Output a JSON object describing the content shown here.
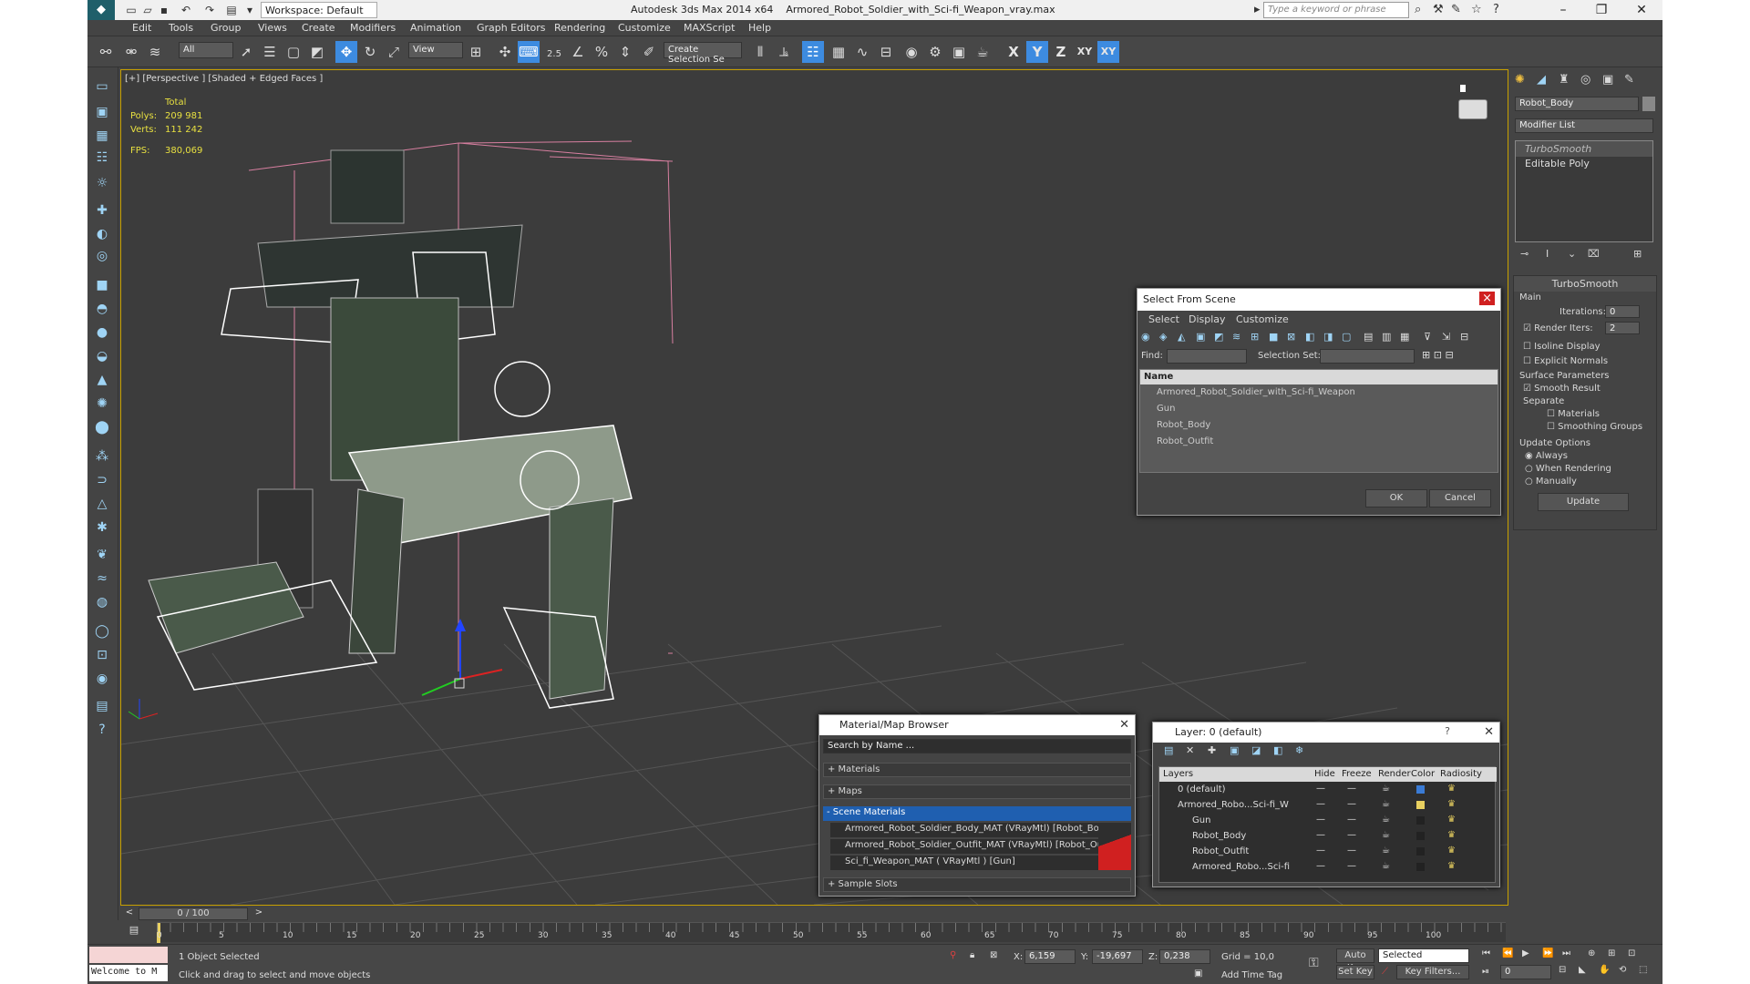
{
  "titlebar": {
    "workspace": "Workspace: Default",
    "app": "Autodesk 3ds Max  2014 x64",
    "file": "Armored_Robot_Soldier_with_Sci-fi_Weapon_vray.max",
    "search_placeholder": "Type a keyword or phrase"
  },
  "menu": [
    "Edit",
    "Tools",
    "Group",
    "Views",
    "Create",
    "Modifiers",
    "Animation",
    "Graph Editors",
    "Rendering",
    "Customize",
    "MAXScript",
    "Help"
  ],
  "toolbar": {
    "filter": "All",
    "refcoord": "View",
    "selset": "Create Selection Se",
    "snap_label": "2.5"
  },
  "viewport": {
    "label": "[+] [Perspective ] [Shaded + Edged Faces ]",
    "total": "Total",
    "polys_k": "Polys:",
    "polys_v": "209 981",
    "verts_k": "Verts:",
    "verts_v": "111 242",
    "fps_k": "FPS:",
    "fps_v": "380,069"
  },
  "command_panel": {
    "object_name": "Robot_Body",
    "modifier_list": "Modifier List",
    "stack": [
      "TurboSmooth",
      "Editable Poly"
    ],
    "turbosmooth": {
      "title": "TurboSmooth",
      "main": "Main",
      "iterations_label": "Iterations:",
      "iterations": "0",
      "render_iters_label": "Render Iters:",
      "render_iters": "2",
      "isoline": "Isoline Display",
      "explicit": "Explicit Normals",
      "surface": "Surface Parameters",
      "smooth_result": "Smooth Result",
      "separate": "Separate",
      "materials": "Materials",
      "smoothing": "Smoothing Groups",
      "update_options": "Update Options",
      "always": "Always",
      "when_rendering": "When Rendering",
      "manually": "Manually",
      "update_btn": "Update"
    }
  },
  "select_scene": {
    "title": "Select From Scene",
    "tabs": [
      "Select",
      "Display",
      "Customize"
    ],
    "find": "Find:",
    "selection_set": "Selection Set:",
    "col_name": "Name",
    "items": [
      "Armored_Robot_Soldier_with_Sci-fi_Weapon",
      "Gun",
      "Robot_Body",
      "Robot_Outfit"
    ],
    "ok": "OK",
    "cancel": "Cancel"
  },
  "mat_browser": {
    "title": "Material/Map Browser",
    "search": "Search by Name ...",
    "groups": [
      "+ Materials",
      "+ Maps",
      "- Scene Materials"
    ],
    "scene_mats": [
      "Armored_Robot_Soldier_Body_MAT (VRayMtl) [Robot_Body]",
      "Armored_Robot_Soldier_Outfit_MAT (VRayMtl) [Robot_Outfit]",
      "Sci_fi_Weapon_MAT ( VRayMtl ) [Gun]"
    ],
    "sample_slots": "+ Sample Slots"
  },
  "layer": {
    "title": "Layer: 0 (default)",
    "help": "?",
    "cols": [
      "Layers",
      "Hide",
      "Freeze",
      "Render",
      "Color",
      "Radiosity"
    ],
    "rows": [
      {
        "name": "0 (default)",
        "indent": 0,
        "color": "#3a7bd5"
      },
      {
        "name": "Armored_Robo...Sci-fi_W",
        "indent": 0,
        "color": "#e8d060"
      },
      {
        "name": "Gun",
        "indent": 1,
        "color": "#222222"
      },
      {
        "name": "Robot_Body",
        "indent": 1,
        "color": "#222222"
      },
      {
        "name": "Robot_Outfit",
        "indent": 1,
        "color": "#222222"
      },
      {
        "name": "Armored_Robo...Sci-fi",
        "indent": 1,
        "color": "#222222"
      }
    ]
  },
  "timeline": {
    "frame": "0 / 100",
    "ticks": [
      "0",
      "5",
      "10",
      "15",
      "20",
      "25",
      "30",
      "35",
      "40",
      "45",
      "50",
      "55",
      "60",
      "65",
      "70",
      "75",
      "80",
      "85",
      "90",
      "95",
      "100"
    ]
  },
  "status": {
    "maxscript": "Welcome to M",
    "selected": "1 Object Selected",
    "prompt": "Click and drag to select and move objects",
    "x_label": "X:",
    "x": "6,159",
    "y_label": "Y:",
    "y": "-19,697",
    "z_label": "Z:",
    "z": "0,238",
    "grid": "Grid = 10,0",
    "add_time_tag": "Add Time Tag",
    "auto_key": "Auto Key",
    "set_key": "Set Key",
    "key_mode": "Selected",
    "key_filters": "Key Filters...",
    "frame": "0"
  },
  "colors": {
    "accent": "#3d8be0",
    "viewport_border": "#c8a000",
    "stats": "#e8e040",
    "scene_mat_highlight": "#1f5fb0",
    "mat_swatch": "#d02020"
  }
}
